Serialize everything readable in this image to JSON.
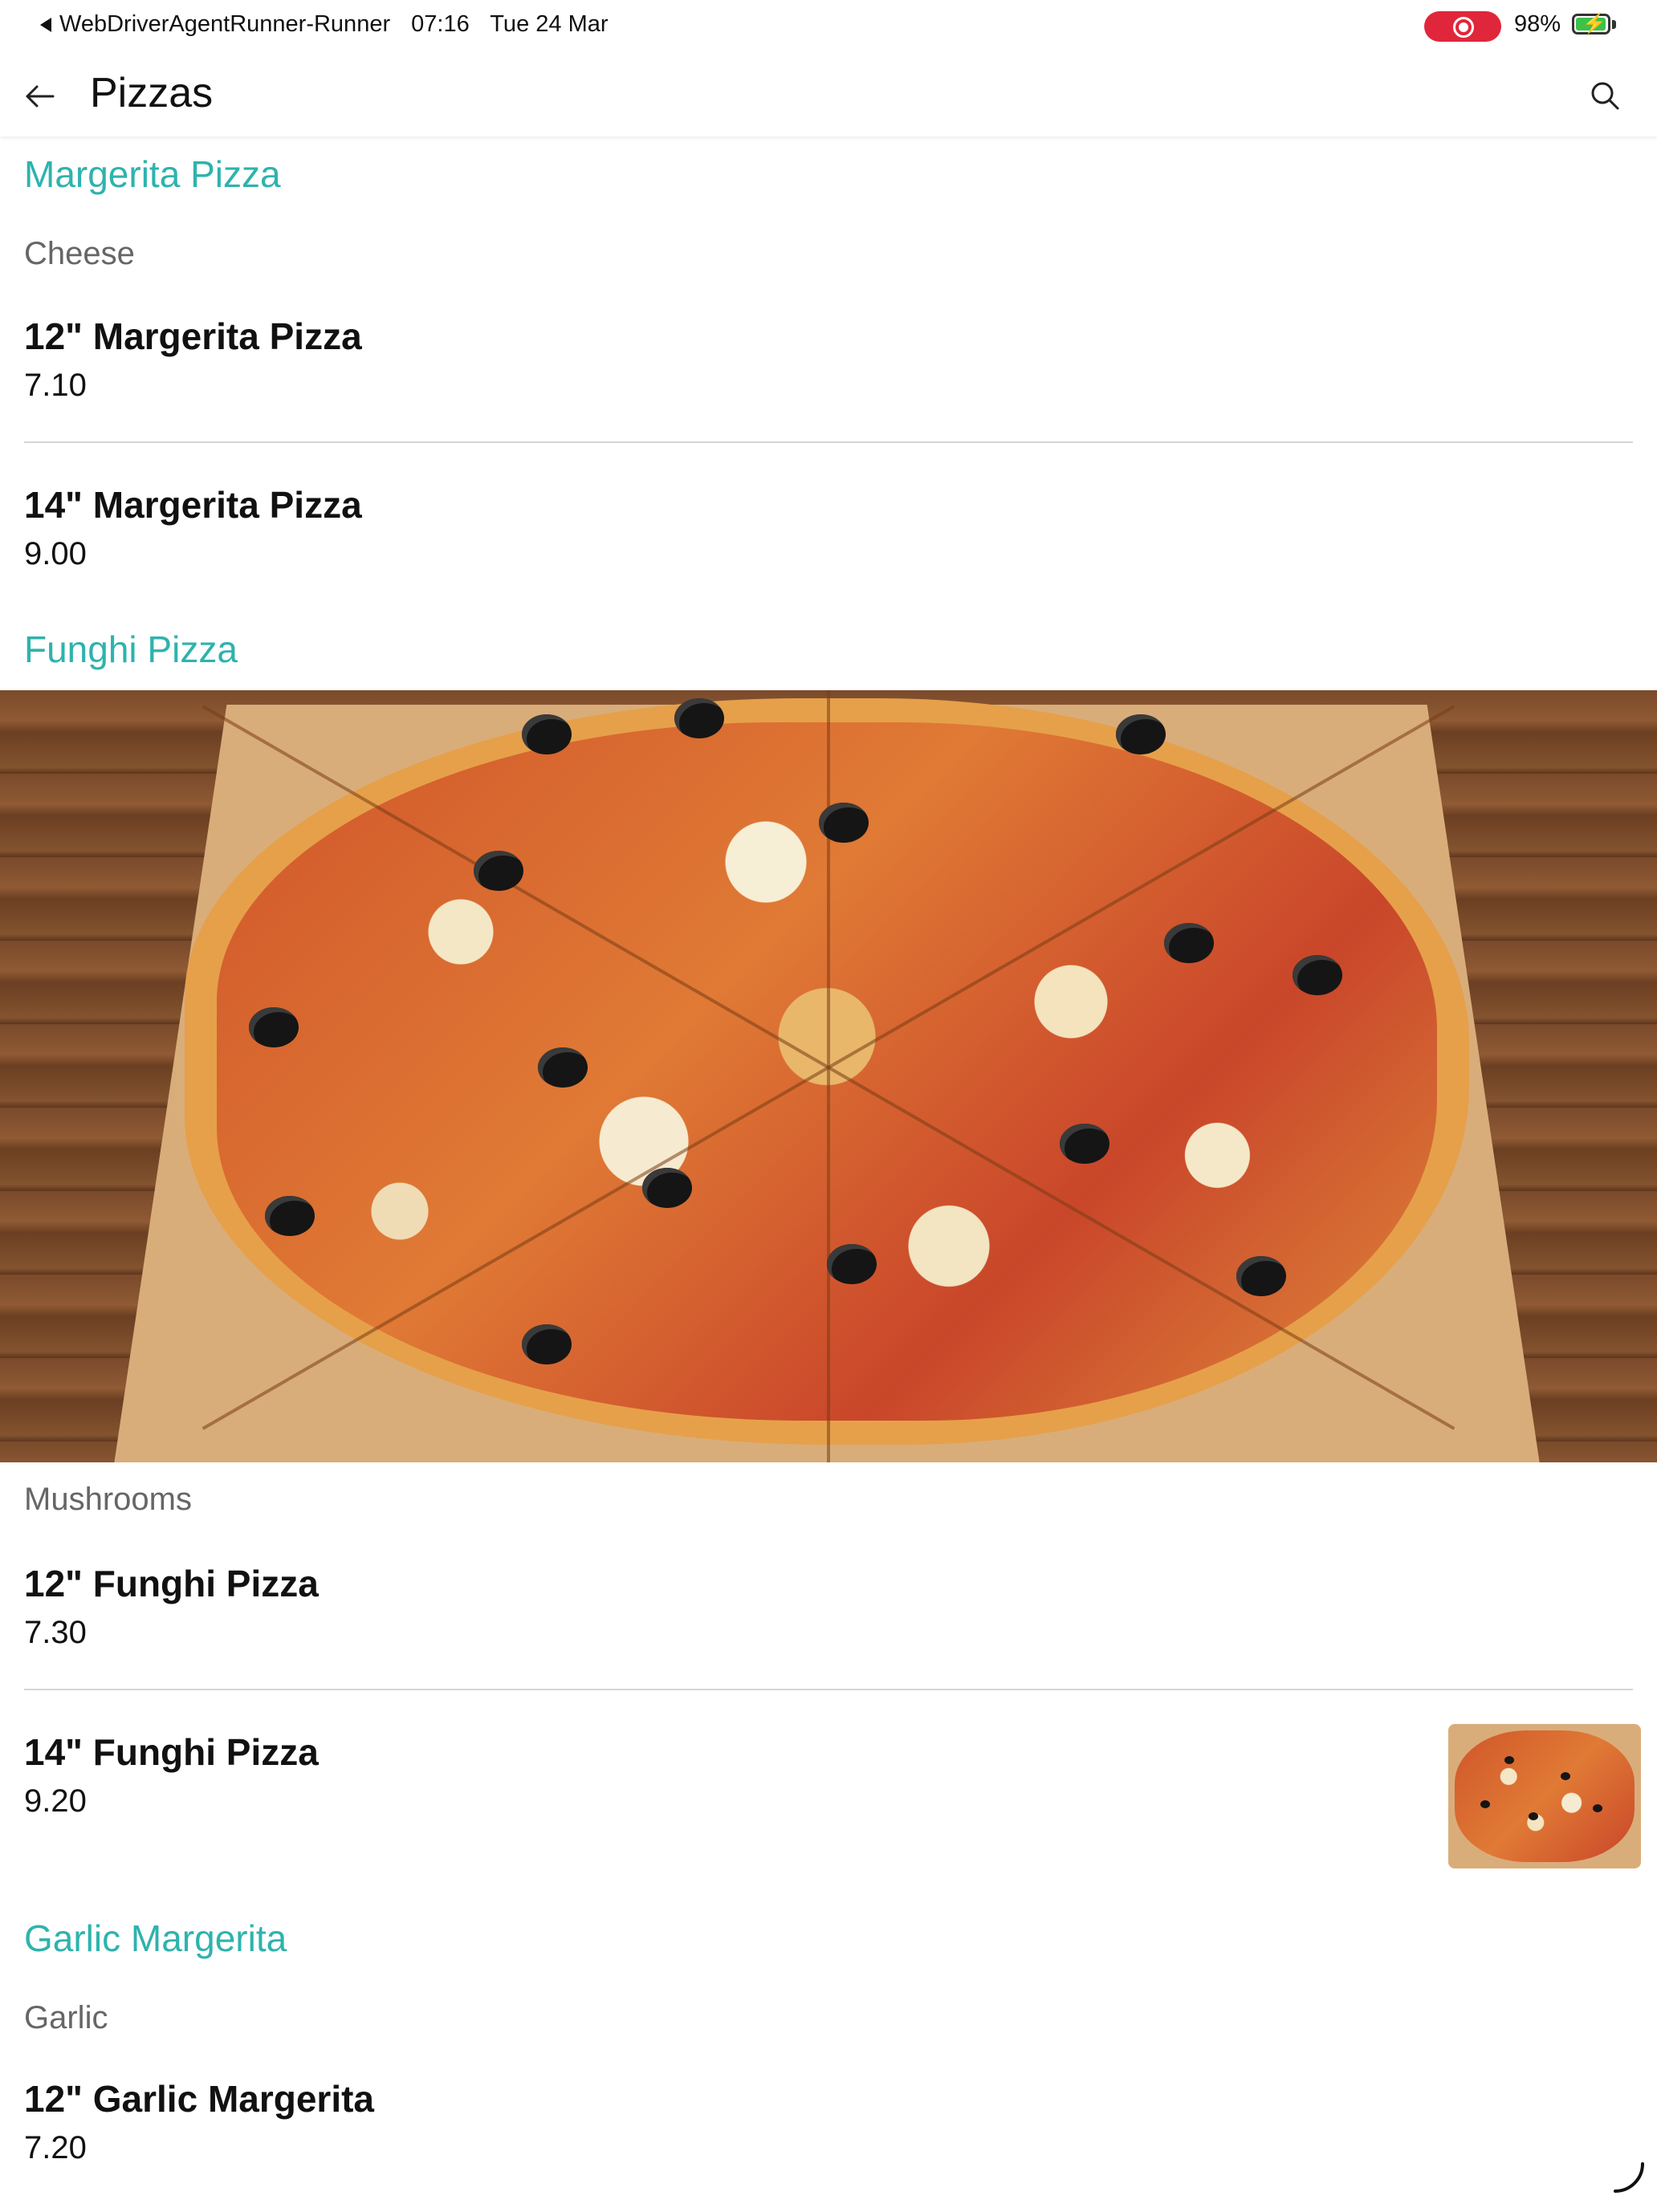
{
  "status_bar": {
    "back_app": "WebDriverAgentRunner-Runner",
    "time": "07:16",
    "date": "Tue 24 Mar",
    "battery": "98%",
    "battery_level": 0.98
  },
  "app_bar": {
    "title": "Pizzas",
    "back_icon": "arrow-left-icon",
    "search_icon": "search-icon"
  },
  "sections": [
    {
      "title": "Margerita Pizza",
      "description": "Cheese",
      "items": [
        {
          "name": "12\" Margerita Pizza",
          "price": "7.10"
        },
        {
          "name": "14\" Margerita Pizza",
          "price": "9.00"
        }
      ]
    },
    {
      "title": "Funghi Pizza",
      "image": "pizza-photo",
      "description": "Mushrooms",
      "items": [
        {
          "name": "12\" Funghi Pizza",
          "price": "7.30"
        },
        {
          "name": "14\" Funghi Pizza",
          "price": "9.20",
          "thumbnail": "pizza-thumbnail"
        }
      ]
    },
    {
      "title": "Garlic Margerita",
      "description": "Garlic",
      "items": [
        {
          "name": "12\" Garlic Margerita",
          "price": "7.20"
        }
      ]
    }
  ],
  "colors": {
    "accent": "#2eb3ad",
    "record": "#e0263b",
    "battery": "#3cc24a"
  }
}
